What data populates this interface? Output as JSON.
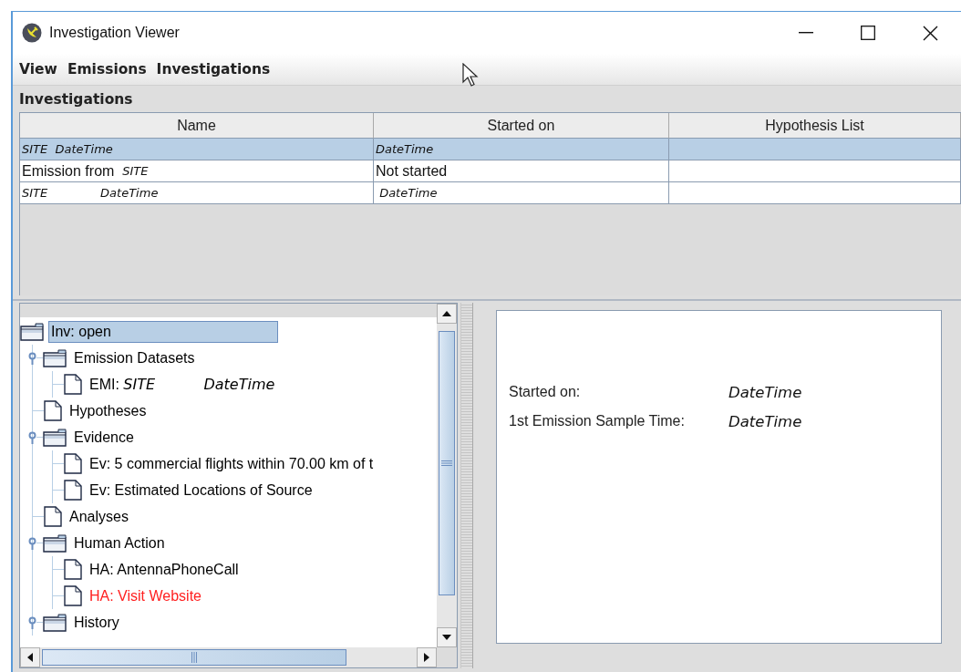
{
  "window": {
    "title": "Investigation Viewer"
  },
  "menu": [
    "View",
    "Emissions",
    "Investigations"
  ],
  "investigations": {
    "title": "Investigations",
    "columns": [
      "Name",
      "Started on",
      "Hypothesis List"
    ],
    "rows": [
      {
        "selected": true,
        "cells": [
          {
            "text": "SITE  DateTime",
            "italic": true
          },
          {
            "text": "DateTime",
            "italic": true
          }
        ]
      },
      {
        "selected": false,
        "cells": [
          {
            "text": "Emission from  *SITE*",
            "italic": false
          },
          {
            "text": "Not started",
            "italic": false
          }
        ]
      },
      {
        "selected": false,
        "cells": [
          {
            "text": "SITE              DateTime",
            "italic": true
          },
          {
            "text": " DateTime",
            "italic": true
          }
        ]
      }
    ]
  },
  "tree": {
    "kind": "folder",
    "label": "Inv: open",
    "selected": true,
    "color": "#000000",
    "children": [
      {
        "kind": "folder",
        "label": "Emission Datasets",
        "selected": false,
        "expanded": true,
        "color": "#000000",
        "children": [
          {
            "kind": "file",
            "label": "EMI: *SITE*            *DateTime*",
            "selected": false,
            "color": "#000000"
          }
        ]
      },
      {
        "kind": "file",
        "label": "Hypotheses",
        "selected": false,
        "color": "#000000"
      },
      {
        "kind": "folder",
        "label": "Evidence",
        "selected": false,
        "expanded": true,
        "color": "#000000",
        "children": [
          {
            "kind": "file",
            "label": "Ev: 5 commercial flights within 70.00 km of t",
            "selected": false,
            "color": "#000000"
          },
          {
            "kind": "file",
            "label": "Ev: Estimated Locations of Source",
            "selected": false,
            "color": "#000000"
          }
        ]
      },
      {
        "kind": "file",
        "label": "Analyses",
        "selected": false,
        "color": "#000000"
      },
      {
        "kind": "folder",
        "label": "Human Action",
        "selected": false,
        "expanded": true,
        "color": "#000000",
        "children": [
          {
            "kind": "file",
            "label": "HA: AntennaPhoneCall",
            "selected": false,
            "color": "#000000"
          },
          {
            "kind": "file",
            "label": "HA: Visit Website",
            "selected": false,
            "color": "#ff2020"
          }
        ]
      },
      {
        "kind": "folder",
        "label": "History",
        "selected": false,
        "expanded": true,
        "color": "#000000"
      }
    ]
  },
  "details": [
    {
      "label": "Started on:",
      "value": "DateTime"
    },
    {
      "label": "1st Emission Sample Time:",
      "value": "DateTime"
    }
  ]
}
